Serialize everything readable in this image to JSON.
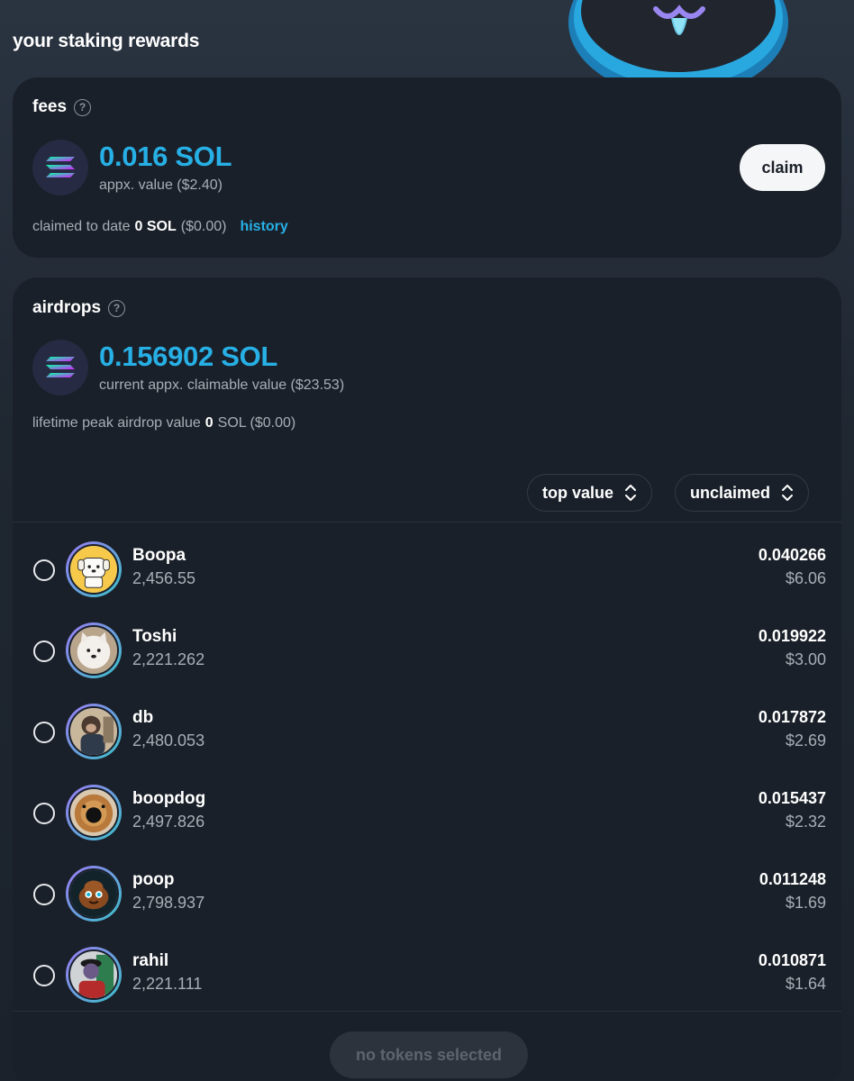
{
  "page": {
    "title": "your staking rewards"
  },
  "fees": {
    "heading": "fees",
    "amount": "0.016 SOL",
    "approx": "appx. value ($2.40)",
    "claim_label": "claim",
    "claimed_prefix": "claimed to date",
    "claimed_amount": "0 SOL",
    "claimed_usd": "($0.00)",
    "history_label": "history"
  },
  "airdrops": {
    "heading": "airdrops",
    "amount": "0.156902 SOL",
    "approx": "current appx. claimable value ($23.53)",
    "peak_prefix": "lifetime peak airdrop value",
    "peak_amount": "0",
    "peak_suffix": "SOL ($0.00)",
    "sort_label": "top value",
    "filter_label": "unclaimed",
    "footer_button": "no tokens selected",
    "tokens": [
      {
        "name": "Boopa",
        "amount": "2,456.55",
        "sol": "0.040266",
        "usd": "$6.06"
      },
      {
        "name": "Toshi",
        "amount": "2,221.262",
        "sol": "0.019922",
        "usd": "$3.00"
      },
      {
        "name": "db",
        "amount": "2,480.053",
        "sol": "0.017872",
        "usd": "$2.69"
      },
      {
        "name": "boopdog",
        "amount": "2,497.826",
        "sol": "0.015437",
        "usd": "$2.32"
      },
      {
        "name": "poop",
        "amount": "2,798.937",
        "sol": "0.011248",
        "usd": "$1.69"
      },
      {
        "name": "rahil",
        "amount": "2,221.111",
        "sol": "0.010871",
        "usd": "$1.64"
      }
    ]
  },
  "colors": {
    "accent": "#27b0e6",
    "card": "#1a2029",
    "muted": "#a8aeb6"
  }
}
